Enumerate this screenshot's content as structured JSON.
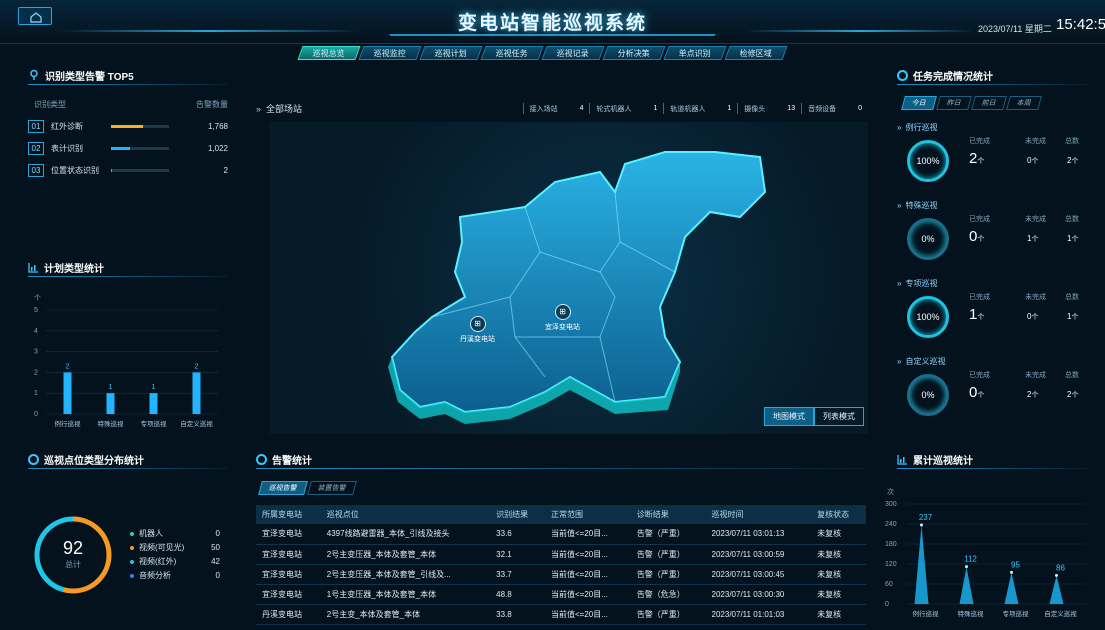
{
  "header": {
    "title": "变电站智能巡视系统",
    "date": "2023/07/11 星期二",
    "time": "15:42:54"
  },
  "nav": {
    "tabs": [
      {
        "label": "巡视总览",
        "active": true
      },
      {
        "label": "巡视监控",
        "active": false
      },
      {
        "label": "巡视计划",
        "active": false
      },
      {
        "label": "巡视任务",
        "active": false
      },
      {
        "label": "巡视记录",
        "active": false
      },
      {
        "label": "分析决策",
        "active": false
      },
      {
        "label": "单点识别",
        "active": false
      },
      {
        "label": "检修区域",
        "active": false
      }
    ]
  },
  "top5": {
    "title": "识别类型告警 TOP5",
    "col_type": "识别类型",
    "col_count": "告警数量",
    "items": [
      {
        "rank": "01",
        "name": "红外诊断",
        "value": "1,768",
        "ratio": 0.55,
        "color": "#f5b21c"
      },
      {
        "rank": "02",
        "name": "表计识别",
        "value": "1,022",
        "ratio": 0.33,
        "color": "#23b4ff"
      },
      {
        "rank": "03",
        "name": "位置状态识别",
        "value": "2",
        "ratio": 0.01,
        "color": "#23b4ff"
      }
    ]
  },
  "plan_chart": {
    "title": "计划类型统计",
    "chart_data": {
      "type": "bar",
      "categories": [
        "例行巡视",
        "特殊巡视",
        "专项巡视",
        "自定义巡视"
      ],
      "values": [
        2,
        1,
        1,
        2
      ],
      "ylabel": "个",
      "ylim": [
        0,
        5
      ],
      "yticks": [
        "0",
        "1",
        "2",
        "3",
        "4",
        "5"
      ]
    }
  },
  "point_dist": {
    "title": "巡视点位类型分布统计",
    "total": "92",
    "total_label": "总计",
    "items": [
      {
        "name": "机器人",
        "value": "0",
        "color": "#2fd0a0"
      },
      {
        "name": "视频(可见光)",
        "value": "50",
        "color": "#f59a23"
      },
      {
        "name": "视频(红外)",
        "value": "42",
        "color": "#1fc6e6"
      },
      {
        "name": "音频分析",
        "value": "0",
        "color": "#3a7bff"
      }
    ]
  },
  "map": {
    "scope": "全部场站",
    "stats": [
      {
        "label": "接入场站",
        "value": "4"
      },
      {
        "label": "轮式机器人",
        "value": "1"
      },
      {
        "label": "轨道机器人",
        "value": "1"
      },
      {
        "label": "摄像头",
        "value": "13"
      },
      {
        "label": "音频设备",
        "value": "0"
      }
    ],
    "stations": [
      {
        "name": "丹溪变电站"
      },
      {
        "name": "宜泽变电站"
      }
    ],
    "mode_map": "地图模式",
    "mode_list": "列表模式"
  },
  "alarms": {
    "title": "告警统计",
    "tabs": [
      "巡视告警",
      "装置告警"
    ],
    "columns": [
      "所属变电站",
      "巡视点位",
      "识别结果",
      "正常范围",
      "诊断结果",
      "巡视时间",
      "复核状态"
    ],
    "rows": [
      [
        "宜泽变电站",
        "4397线路避雷器_本体_引线及接头",
        "33.6",
        "当前值<=20目...",
        "告警（严重）",
        "2023/07/11 03:01:13",
        "未复核"
      ],
      [
        "宜泽变电站",
        "2号主变压器_本体及套管_本体",
        "32.1",
        "当前值<=20目...",
        "告警（严重）",
        "2023/07/11 03:00:59",
        "未复核"
      ],
      [
        "宜泽变电站",
        "2号主变压器_本体及套管_引线及...",
        "33.7",
        "当前值<=20目...",
        "告警（严重）",
        "2023/07/11 03:00:45",
        "未复核"
      ],
      [
        "宜泽变电站",
        "1号主变压器_本体及套管_本体",
        "48.8",
        "当前值<=20目...",
        "告警（危急）",
        "2023/07/11 03:00:30",
        "未复核"
      ],
      [
        "丹溪变电站",
        "2号主变_本体及套管_本体",
        "33.8",
        "当前值<=20目...",
        "告警（严重）",
        "2023/07/11 01:01:03",
        "未复核"
      ]
    ]
  },
  "tasks": {
    "title": "任务完成情况统计",
    "tabs": [
      "今日",
      "昨日",
      "前日",
      "本周"
    ],
    "col_done": "已完成",
    "col_undone": "未完成",
    "col_total": "总数",
    "items": [
      {
        "name": "例行巡视",
        "pct": "100%",
        "done": "2",
        "undone": "0",
        "total": "2"
      },
      {
        "name": "特殊巡视",
        "pct": "0%",
        "done": "0",
        "undone": "1",
        "total": "1"
      },
      {
        "name": "专项巡视",
        "pct": "100%",
        "done": "1",
        "undone": "0",
        "total": "1"
      },
      {
        "name": "自定义巡视",
        "pct": "0%",
        "done": "0",
        "undone": "2",
        "total": "2"
      }
    ],
    "unit": "个"
  },
  "cumulative": {
    "title": "累计巡视统计",
    "chart_data": {
      "type": "area",
      "categories": [
        "例行巡视",
        "特殊巡视",
        "专项巡视",
        "自定义巡视"
      ],
      "values": [
        237,
        112,
        95,
        86
      ],
      "ylabel": "次",
      "ylim": [
        0,
        300
      ],
      "yticks": [
        "0",
        "60",
        "120",
        "180",
        "240",
        "300"
      ]
    }
  }
}
